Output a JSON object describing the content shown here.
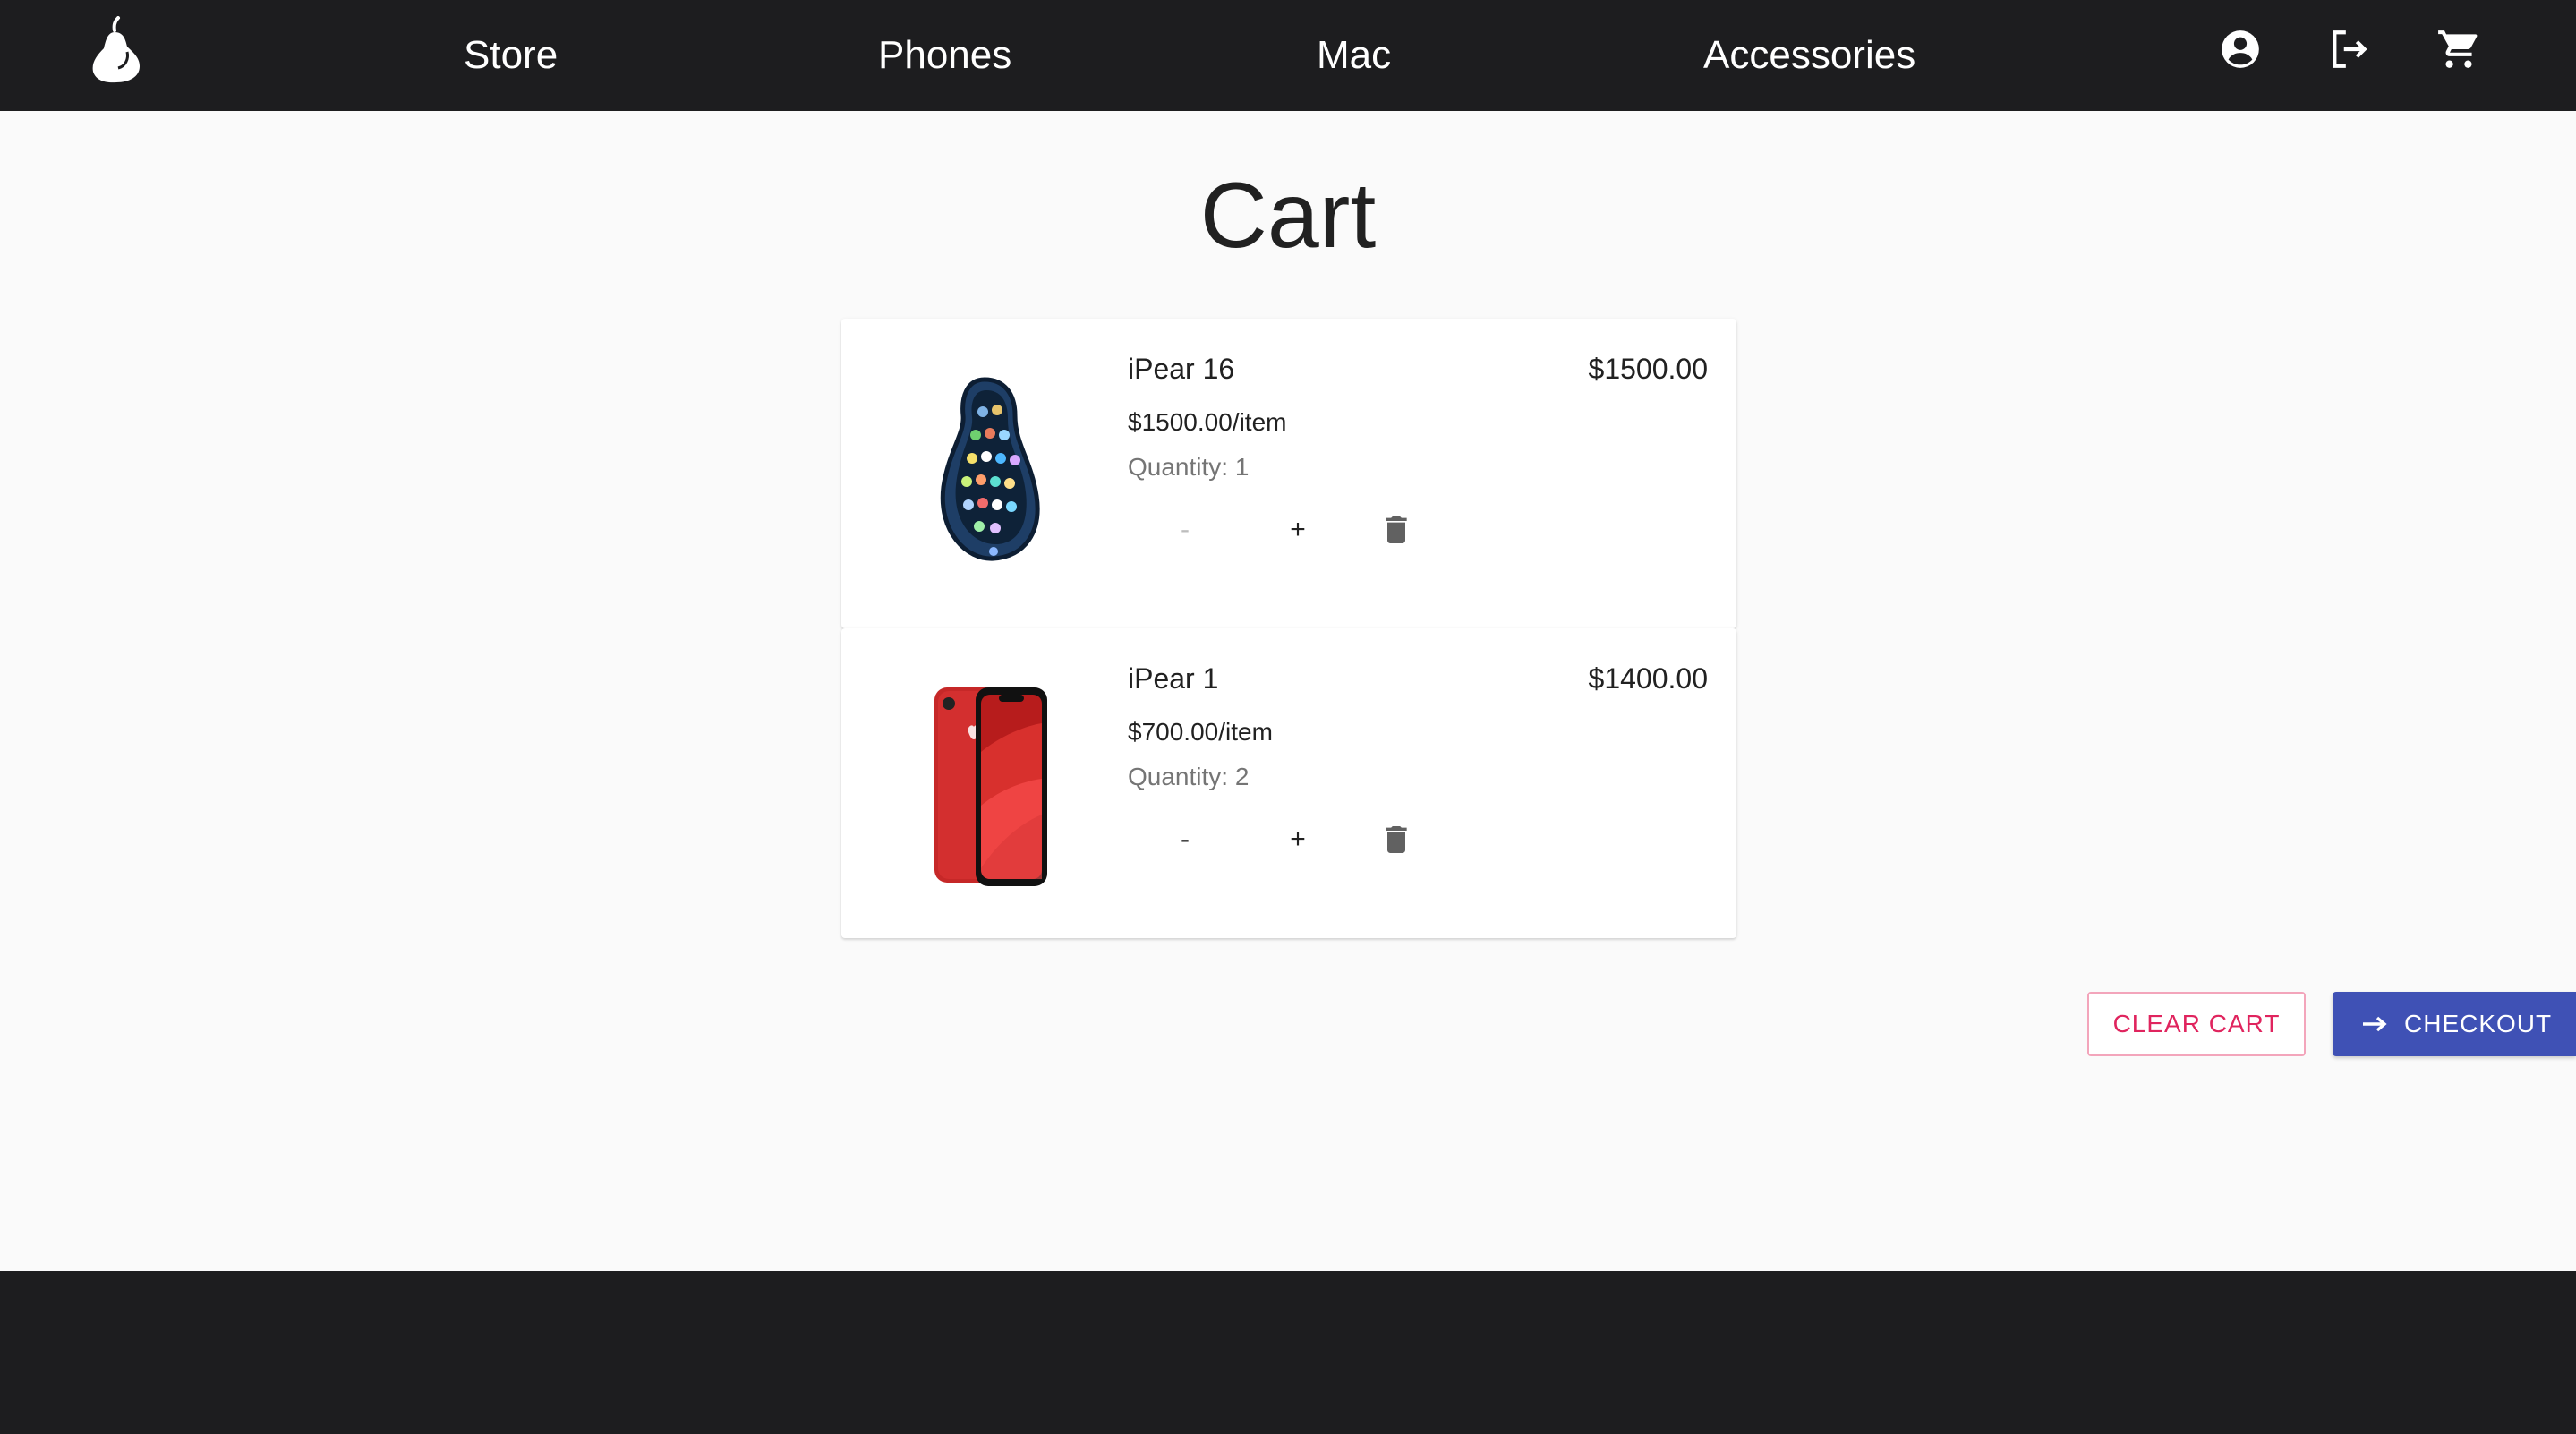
{
  "nav": {
    "logo": "pear-logo",
    "links": [
      "Store",
      "Phones",
      "Mac",
      "Accessories"
    ],
    "icons": [
      "account-circle-icon",
      "logout-icon",
      "cart-icon"
    ]
  },
  "page": {
    "title": "Cart"
  },
  "cart": {
    "items": [
      {
        "name": "iPear 16",
        "unit_price": "$1500.00/item",
        "quantity": "Quantity: 1",
        "total": "$1500.00",
        "decrement": "-",
        "increment": "+",
        "decrement_disabled": true,
        "image": "pear-phone-image"
      },
      {
        "name": "iPear 1",
        "unit_price": "$700.00/item",
        "quantity": "Quantity: 2",
        "total": "$1400.00",
        "decrement": "-",
        "increment": "+",
        "decrement_disabled": false,
        "image": "red-phone-image"
      }
    ]
  },
  "actions": {
    "clear_label": "CLEAR CART",
    "checkout_label": "CHECKOUT"
  },
  "colors": {
    "header_bg": "#1d1d1f",
    "page_bg": "#fafafa",
    "accent": "#3f51b5",
    "danger": "#e0245e"
  }
}
